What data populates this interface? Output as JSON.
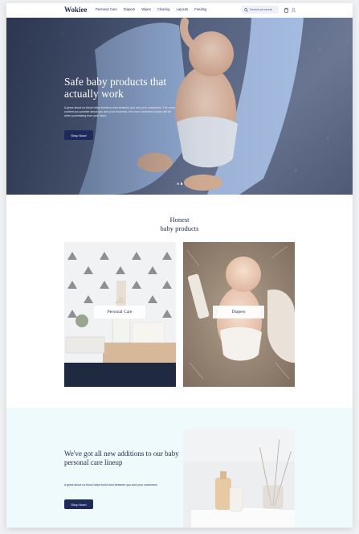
{
  "header": {
    "logo": "Wokiee",
    "nav": [
      "Personal Care",
      "Diapers",
      "Wipes",
      "Clearing",
      "Layouts",
      "Feeding"
    ],
    "search_placeholder": "Search products",
    "icons": [
      "search-icon",
      "cart-icon",
      "user-icon"
    ]
  },
  "hero": {
    "title": "Safe baby products that actually work",
    "description": "A great about us block helps builders trust between you and your customers. The more content you provide about you and your business, the more confident people will be when purchasing from your store.",
    "cta": "Shop Now!",
    "slides": 2,
    "active_slide": 1
  },
  "products": {
    "title_line1": "Honest",
    "title_line2": "baby products",
    "cards": [
      {
        "label": "Personal Care"
      },
      {
        "label": "Diapers"
      }
    ]
  },
  "additions": {
    "title": "We've got all new additions to our baby personal care lineup",
    "description": "A great about us block helps build trust between you and your customers.",
    "cta": "Shop Now!"
  },
  "colors": {
    "navy": "#1f2a5c",
    "mint_bg": "#eefafc",
    "text": "#1f2a4d"
  }
}
